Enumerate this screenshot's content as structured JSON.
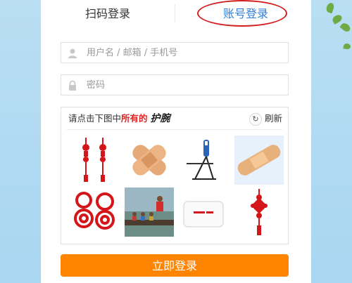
{
  "tabs": {
    "qr_login": "扫码登录",
    "account_login": "账号登录"
  },
  "fields": {
    "username_placeholder": "用户名 / 邮箱 / 手机号",
    "password_placeholder": "密码"
  },
  "captcha": {
    "prompt_prefix": "请点击下图中",
    "prompt_highlight": "所有的",
    "keyword": "护腕",
    "refresh_label": "刷新",
    "images": [
      "red-chinese-knot-tassels",
      "adhesive-bandage-cross",
      "pommel-horse-gymnastics",
      "adhesive-bandage",
      "red-paper-cutting",
      "dragon-boat-rowing",
      "white-wristband",
      "red-chinese-knot"
    ]
  },
  "submit_label": "立即登录",
  "colors": {
    "accent_blue": "#2f7fd9",
    "highlight_red": "#e32121",
    "button_orange": "#ff8400",
    "annotation_ring": "#d21e1e"
  }
}
